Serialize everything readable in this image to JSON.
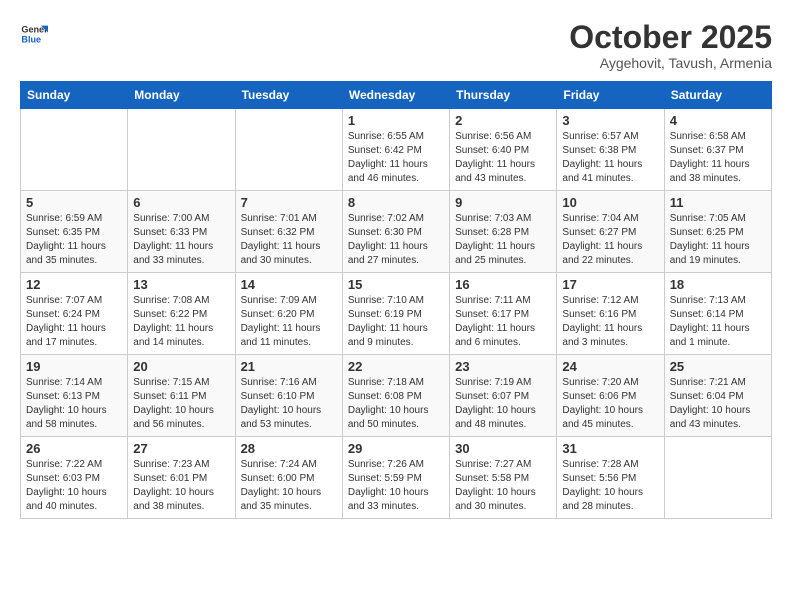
{
  "header": {
    "logo_general": "General",
    "logo_blue": "Blue",
    "month": "October 2025",
    "location": "Aygehovit, Tavush, Armenia"
  },
  "weekdays": [
    "Sunday",
    "Monday",
    "Tuesday",
    "Wednesday",
    "Thursday",
    "Friday",
    "Saturday"
  ],
  "weeks": [
    [
      {
        "day": "",
        "info": ""
      },
      {
        "day": "",
        "info": ""
      },
      {
        "day": "",
        "info": ""
      },
      {
        "day": "1",
        "info": "Sunrise: 6:55 AM\nSunset: 6:42 PM\nDaylight: 11 hours\nand 46 minutes."
      },
      {
        "day": "2",
        "info": "Sunrise: 6:56 AM\nSunset: 6:40 PM\nDaylight: 11 hours\nand 43 minutes."
      },
      {
        "day": "3",
        "info": "Sunrise: 6:57 AM\nSunset: 6:38 PM\nDaylight: 11 hours\nand 41 minutes."
      },
      {
        "day": "4",
        "info": "Sunrise: 6:58 AM\nSunset: 6:37 PM\nDaylight: 11 hours\nand 38 minutes."
      }
    ],
    [
      {
        "day": "5",
        "info": "Sunrise: 6:59 AM\nSunset: 6:35 PM\nDaylight: 11 hours\nand 35 minutes."
      },
      {
        "day": "6",
        "info": "Sunrise: 7:00 AM\nSunset: 6:33 PM\nDaylight: 11 hours\nand 33 minutes."
      },
      {
        "day": "7",
        "info": "Sunrise: 7:01 AM\nSunset: 6:32 PM\nDaylight: 11 hours\nand 30 minutes."
      },
      {
        "day": "8",
        "info": "Sunrise: 7:02 AM\nSunset: 6:30 PM\nDaylight: 11 hours\nand 27 minutes."
      },
      {
        "day": "9",
        "info": "Sunrise: 7:03 AM\nSunset: 6:28 PM\nDaylight: 11 hours\nand 25 minutes."
      },
      {
        "day": "10",
        "info": "Sunrise: 7:04 AM\nSunset: 6:27 PM\nDaylight: 11 hours\nand 22 minutes."
      },
      {
        "day": "11",
        "info": "Sunrise: 7:05 AM\nSunset: 6:25 PM\nDaylight: 11 hours\nand 19 minutes."
      }
    ],
    [
      {
        "day": "12",
        "info": "Sunrise: 7:07 AM\nSunset: 6:24 PM\nDaylight: 11 hours\nand 17 minutes."
      },
      {
        "day": "13",
        "info": "Sunrise: 7:08 AM\nSunset: 6:22 PM\nDaylight: 11 hours\nand 14 minutes."
      },
      {
        "day": "14",
        "info": "Sunrise: 7:09 AM\nSunset: 6:20 PM\nDaylight: 11 hours\nand 11 minutes."
      },
      {
        "day": "15",
        "info": "Sunrise: 7:10 AM\nSunset: 6:19 PM\nDaylight: 11 hours\nand 9 minutes."
      },
      {
        "day": "16",
        "info": "Sunrise: 7:11 AM\nSunset: 6:17 PM\nDaylight: 11 hours\nand 6 minutes."
      },
      {
        "day": "17",
        "info": "Sunrise: 7:12 AM\nSunset: 6:16 PM\nDaylight: 11 hours\nand 3 minutes."
      },
      {
        "day": "18",
        "info": "Sunrise: 7:13 AM\nSunset: 6:14 PM\nDaylight: 11 hours\nand 1 minute."
      }
    ],
    [
      {
        "day": "19",
        "info": "Sunrise: 7:14 AM\nSunset: 6:13 PM\nDaylight: 10 hours\nand 58 minutes."
      },
      {
        "day": "20",
        "info": "Sunrise: 7:15 AM\nSunset: 6:11 PM\nDaylight: 10 hours\nand 56 minutes."
      },
      {
        "day": "21",
        "info": "Sunrise: 7:16 AM\nSunset: 6:10 PM\nDaylight: 10 hours\nand 53 minutes."
      },
      {
        "day": "22",
        "info": "Sunrise: 7:18 AM\nSunset: 6:08 PM\nDaylight: 10 hours\nand 50 minutes."
      },
      {
        "day": "23",
        "info": "Sunrise: 7:19 AM\nSunset: 6:07 PM\nDaylight: 10 hours\nand 48 minutes."
      },
      {
        "day": "24",
        "info": "Sunrise: 7:20 AM\nSunset: 6:06 PM\nDaylight: 10 hours\nand 45 minutes."
      },
      {
        "day": "25",
        "info": "Sunrise: 7:21 AM\nSunset: 6:04 PM\nDaylight: 10 hours\nand 43 minutes."
      }
    ],
    [
      {
        "day": "26",
        "info": "Sunrise: 7:22 AM\nSunset: 6:03 PM\nDaylight: 10 hours\nand 40 minutes."
      },
      {
        "day": "27",
        "info": "Sunrise: 7:23 AM\nSunset: 6:01 PM\nDaylight: 10 hours\nand 38 minutes."
      },
      {
        "day": "28",
        "info": "Sunrise: 7:24 AM\nSunset: 6:00 PM\nDaylight: 10 hours\nand 35 minutes."
      },
      {
        "day": "29",
        "info": "Sunrise: 7:26 AM\nSunset: 5:59 PM\nDaylight: 10 hours\nand 33 minutes."
      },
      {
        "day": "30",
        "info": "Sunrise: 7:27 AM\nSunset: 5:58 PM\nDaylight: 10 hours\nand 30 minutes."
      },
      {
        "day": "31",
        "info": "Sunrise: 7:28 AM\nSunset: 5:56 PM\nDaylight: 10 hours\nand 28 minutes."
      },
      {
        "day": "",
        "info": ""
      }
    ]
  ]
}
